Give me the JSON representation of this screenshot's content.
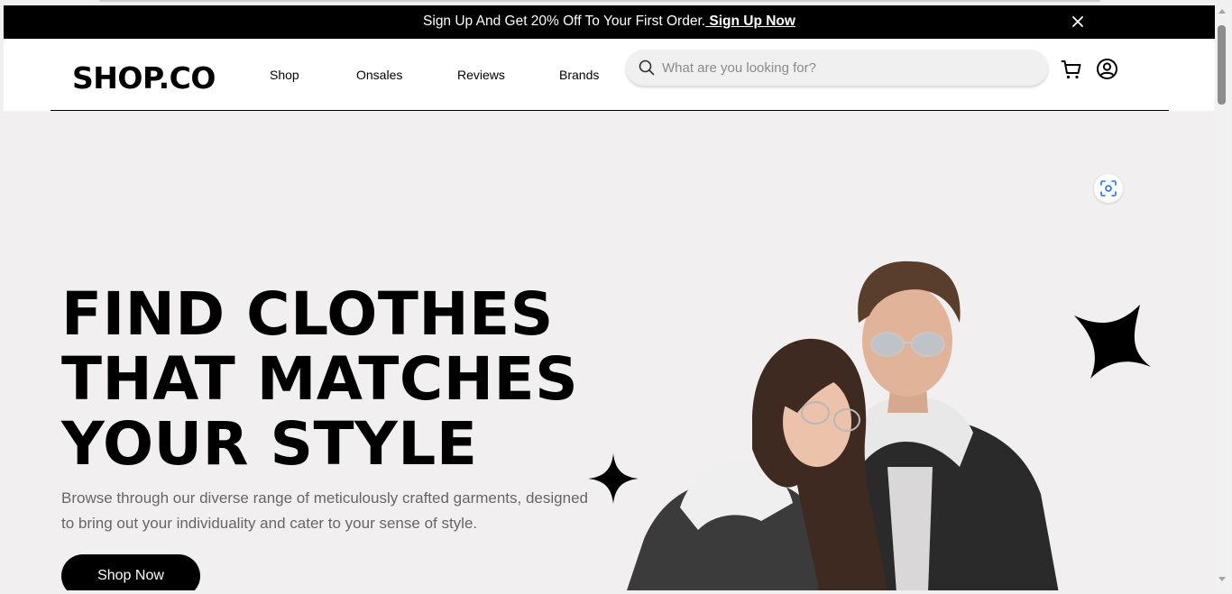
{
  "promo": {
    "text": "Sign Up And Get 20% Off To Your First Order.",
    "link": " Sign Up Now",
    "close_icon": "close-icon"
  },
  "header": {
    "logo": "SHOP.CO",
    "nav": [
      {
        "label": "Shop"
      },
      {
        "label": "Onsales"
      },
      {
        "label": "Reviews"
      },
      {
        "label": "Brands"
      }
    ],
    "search": {
      "placeholder": "What are you looking for?",
      "value": "",
      "icon": "search-icon"
    },
    "icons": [
      "cart-icon",
      "user-icon"
    ]
  },
  "hero": {
    "headline": [
      "FIND CLOTHES",
      "THAT MATCHES",
      "YOUR STYLE"
    ],
    "subtext": "Browse through our diverse range of meticulously crafted garments, designed to bring out your individuality and cater to your sense of style.",
    "cta": "Shop Now",
    "decorations": [
      "sparkle-star-icon",
      "sparkle-star-icon"
    ],
    "lens_icon": "visual-search-icon",
    "image": "couple-photo"
  },
  "colors": {
    "promo_bg": "#000000",
    "hero_bg": "#f1eff0",
    "button_bg": "#000000",
    "search_bg": "#f0f0f0"
  }
}
